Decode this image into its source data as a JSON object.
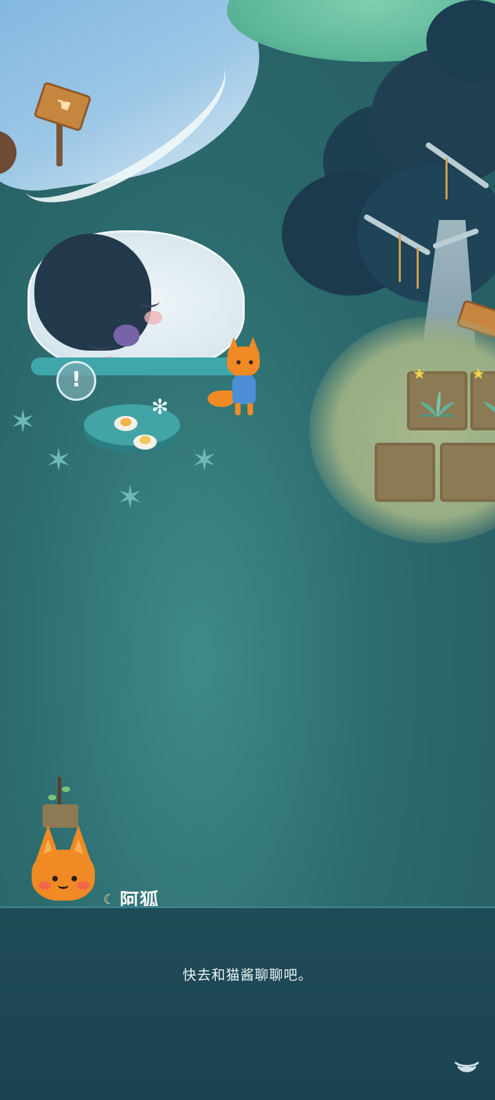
{
  "dialog": {
    "speaker_name": "阿狐",
    "text": "快去和猫酱聊聊吧。"
  },
  "icons": {
    "name_moon": "crescent-moon-icon",
    "continue": "chevron-down-icon",
    "alert": "exclamation-icon"
  },
  "alert_symbol": "!",
  "colors": {
    "dialog_bg": "#1f4a57",
    "fox_orange": "#f08a24",
    "scene_teal": "#2f6f72"
  }
}
